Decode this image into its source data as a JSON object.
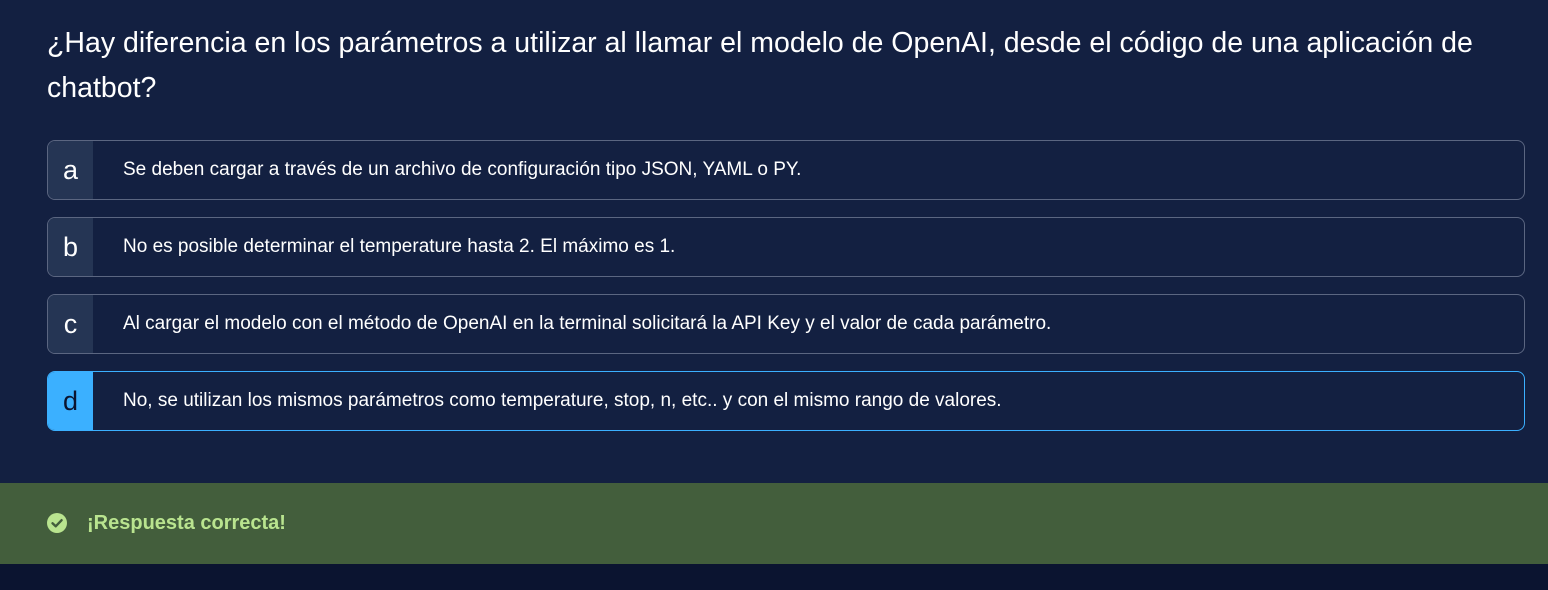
{
  "question": "¿Hay diferencia en los parámetros a utilizar al llamar el modelo de OpenAI, desde el código de una aplicación de chatbot?",
  "options": [
    {
      "letter": "a",
      "text": "Se deben cargar a través de un archivo de configuración tipo JSON, YAML o PY.",
      "selected": false
    },
    {
      "letter": "b",
      "text": "No es posible determinar el temperature hasta 2. El máximo es 1.",
      "selected": false
    },
    {
      "letter": "c",
      "text": "Al cargar el modelo con el método de OpenAI en la terminal solicitará la API Key y el valor de cada parámetro.",
      "selected": false
    },
    {
      "letter": "d",
      "text": "No, se utilizan los mismos parámetros como temperature, stop, n, etc.. y con el mismo rango de valores.",
      "selected": true
    }
  ],
  "feedback": {
    "icon": "check-circle-icon",
    "message": "¡Respuesta correcta!"
  },
  "colors": {
    "background": "#132041",
    "accent": "#3bb0ff",
    "success_bg": "#435e3c",
    "success_text": "#b9e48f"
  }
}
